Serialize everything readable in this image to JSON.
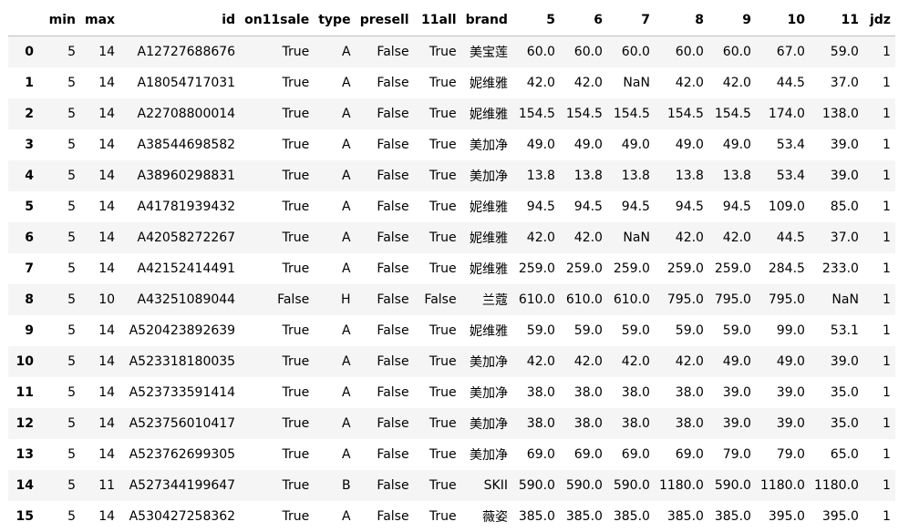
{
  "dataframe": {
    "columns": [
      "",
      "min",
      "max",
      "id",
      "on11sale",
      "type",
      "presell",
      "11all",
      "brand",
      "5",
      "6",
      "7",
      "8",
      "9",
      "10",
      "11",
      "jdz"
    ],
    "rows": [
      {
        "index": "0",
        "cells": [
          "5",
          "14",
          "A12727688676",
          "True",
          "A",
          "False",
          "True",
          "美宝莲",
          "60.0",
          "60.0",
          "60.0",
          "60.0",
          "60.0",
          "67.0",
          "59.0",
          "1"
        ]
      },
      {
        "index": "1",
        "cells": [
          "5",
          "14",
          "A18054717031",
          "True",
          "A",
          "False",
          "True",
          "妮维雅",
          "42.0",
          "42.0",
          "NaN",
          "42.0",
          "42.0",
          "44.5",
          "37.0",
          "1"
        ]
      },
      {
        "index": "2",
        "cells": [
          "5",
          "14",
          "A22708800014",
          "True",
          "A",
          "False",
          "True",
          "妮维雅",
          "154.5",
          "154.5",
          "154.5",
          "154.5",
          "154.5",
          "174.0",
          "138.0",
          "1"
        ]
      },
      {
        "index": "3",
        "cells": [
          "5",
          "14",
          "A38544698582",
          "True",
          "A",
          "False",
          "True",
          "美加净",
          "49.0",
          "49.0",
          "49.0",
          "49.0",
          "49.0",
          "53.4",
          "39.0",
          "1"
        ]
      },
      {
        "index": "4",
        "cells": [
          "5",
          "14",
          "A38960298831",
          "True",
          "A",
          "False",
          "True",
          "美加净",
          "13.8",
          "13.8",
          "13.8",
          "13.8",
          "13.8",
          "53.4",
          "39.0",
          "1"
        ]
      },
      {
        "index": "5",
        "cells": [
          "5",
          "14",
          "A41781939432",
          "True",
          "A",
          "False",
          "True",
          "妮维雅",
          "94.5",
          "94.5",
          "94.5",
          "94.5",
          "94.5",
          "109.0",
          "85.0",
          "1"
        ]
      },
      {
        "index": "6",
        "cells": [
          "5",
          "14",
          "A42058272267",
          "True",
          "A",
          "False",
          "True",
          "妮维雅",
          "42.0",
          "42.0",
          "NaN",
          "42.0",
          "42.0",
          "44.5",
          "37.0",
          "1"
        ]
      },
      {
        "index": "7",
        "cells": [
          "5",
          "14",
          "A42152414491",
          "True",
          "A",
          "False",
          "True",
          "妮维雅",
          "259.0",
          "259.0",
          "259.0",
          "259.0",
          "259.0",
          "284.5",
          "233.0",
          "1"
        ]
      },
      {
        "index": "8",
        "cells": [
          "5",
          "10",
          "A43251089044",
          "False",
          "H",
          "False",
          "False",
          "兰蔻",
          "610.0",
          "610.0",
          "610.0",
          "795.0",
          "795.0",
          "795.0",
          "NaN",
          "1"
        ]
      },
      {
        "index": "9",
        "cells": [
          "5",
          "14",
          "A520423892639",
          "True",
          "A",
          "False",
          "True",
          "妮维雅",
          "59.0",
          "59.0",
          "59.0",
          "59.0",
          "59.0",
          "99.0",
          "53.1",
          "1"
        ]
      },
      {
        "index": "10",
        "cells": [
          "5",
          "14",
          "A523318180035",
          "True",
          "A",
          "False",
          "True",
          "美加净",
          "42.0",
          "42.0",
          "42.0",
          "42.0",
          "49.0",
          "49.0",
          "39.0",
          "1"
        ]
      },
      {
        "index": "11",
        "cells": [
          "5",
          "14",
          "A523733591414",
          "True",
          "A",
          "False",
          "True",
          "美加净",
          "38.0",
          "38.0",
          "38.0",
          "38.0",
          "39.0",
          "39.0",
          "35.0",
          "1"
        ]
      },
      {
        "index": "12",
        "cells": [
          "5",
          "14",
          "A523756010417",
          "True",
          "A",
          "False",
          "True",
          "美加净",
          "38.0",
          "38.0",
          "38.0",
          "38.0",
          "39.0",
          "39.0",
          "35.0",
          "1"
        ]
      },
      {
        "index": "13",
        "cells": [
          "5",
          "14",
          "A523762699305",
          "True",
          "A",
          "False",
          "True",
          "美加净",
          "69.0",
          "69.0",
          "69.0",
          "69.0",
          "79.0",
          "79.0",
          "65.0",
          "1"
        ]
      },
      {
        "index": "14",
        "cells": [
          "5",
          "11",
          "A527344199647",
          "True",
          "B",
          "False",
          "True",
          "SKII",
          "590.0",
          "590.0",
          "590.0",
          "1180.0",
          "590.0",
          "1180.0",
          "1180.0",
          "1"
        ]
      },
      {
        "index": "15",
        "cells": [
          "5",
          "14",
          "A530427258362",
          "True",
          "A",
          "False",
          "True",
          "薇姿",
          "385.0",
          "385.0",
          "385.0",
          "385.0",
          "385.0",
          "395.0",
          "395.0",
          "1"
        ]
      }
    ]
  }
}
